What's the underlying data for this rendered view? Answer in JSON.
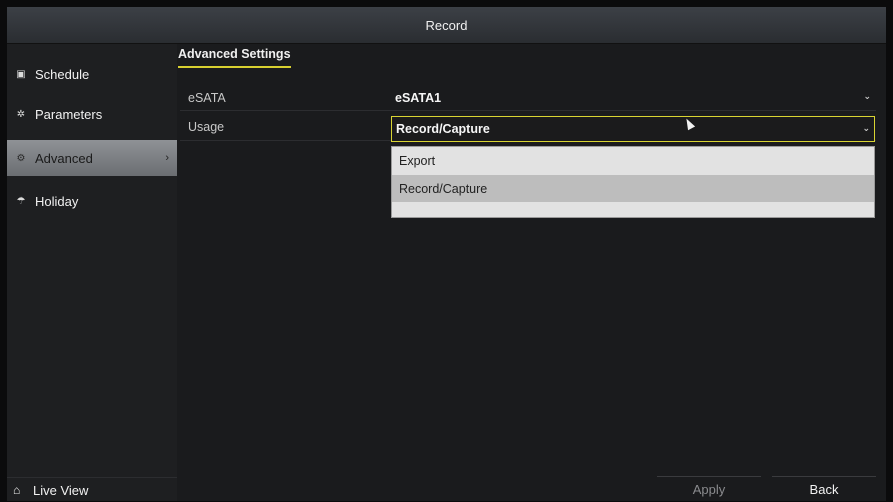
{
  "window": {
    "title": "Record"
  },
  "sidebar": {
    "items": [
      {
        "label": "Schedule",
        "icon": "calendar-icon",
        "glyph": "▣"
      },
      {
        "label": "Parameters",
        "icon": "gear-icon",
        "glyph": "✲"
      },
      {
        "label": "Advanced",
        "icon": "advanced-gears-icon",
        "glyph": "⚙",
        "active": true,
        "arrow": "›"
      },
      {
        "label": "Holiday",
        "icon": "holiday-icon",
        "glyph": "☂"
      }
    ],
    "live_view": {
      "label": "Live View",
      "icon": "home-icon",
      "glyph": "⌂"
    }
  },
  "main": {
    "tab": "Advanced Settings",
    "rows": [
      {
        "label": "eSATA",
        "value": "eSATA1"
      },
      {
        "label": "Usage",
        "value": "Record/Capture"
      }
    ],
    "dropdown": {
      "options": [
        "Export",
        "Record/Capture"
      ],
      "selected": "Record/Capture"
    }
  },
  "footer": {
    "apply_label": "Apply",
    "back_label": "Back"
  },
  "colors": {
    "accent": "#d9d432",
    "active_item": "#7d8084",
    "dropdown_bg": "#e2e2e2"
  }
}
